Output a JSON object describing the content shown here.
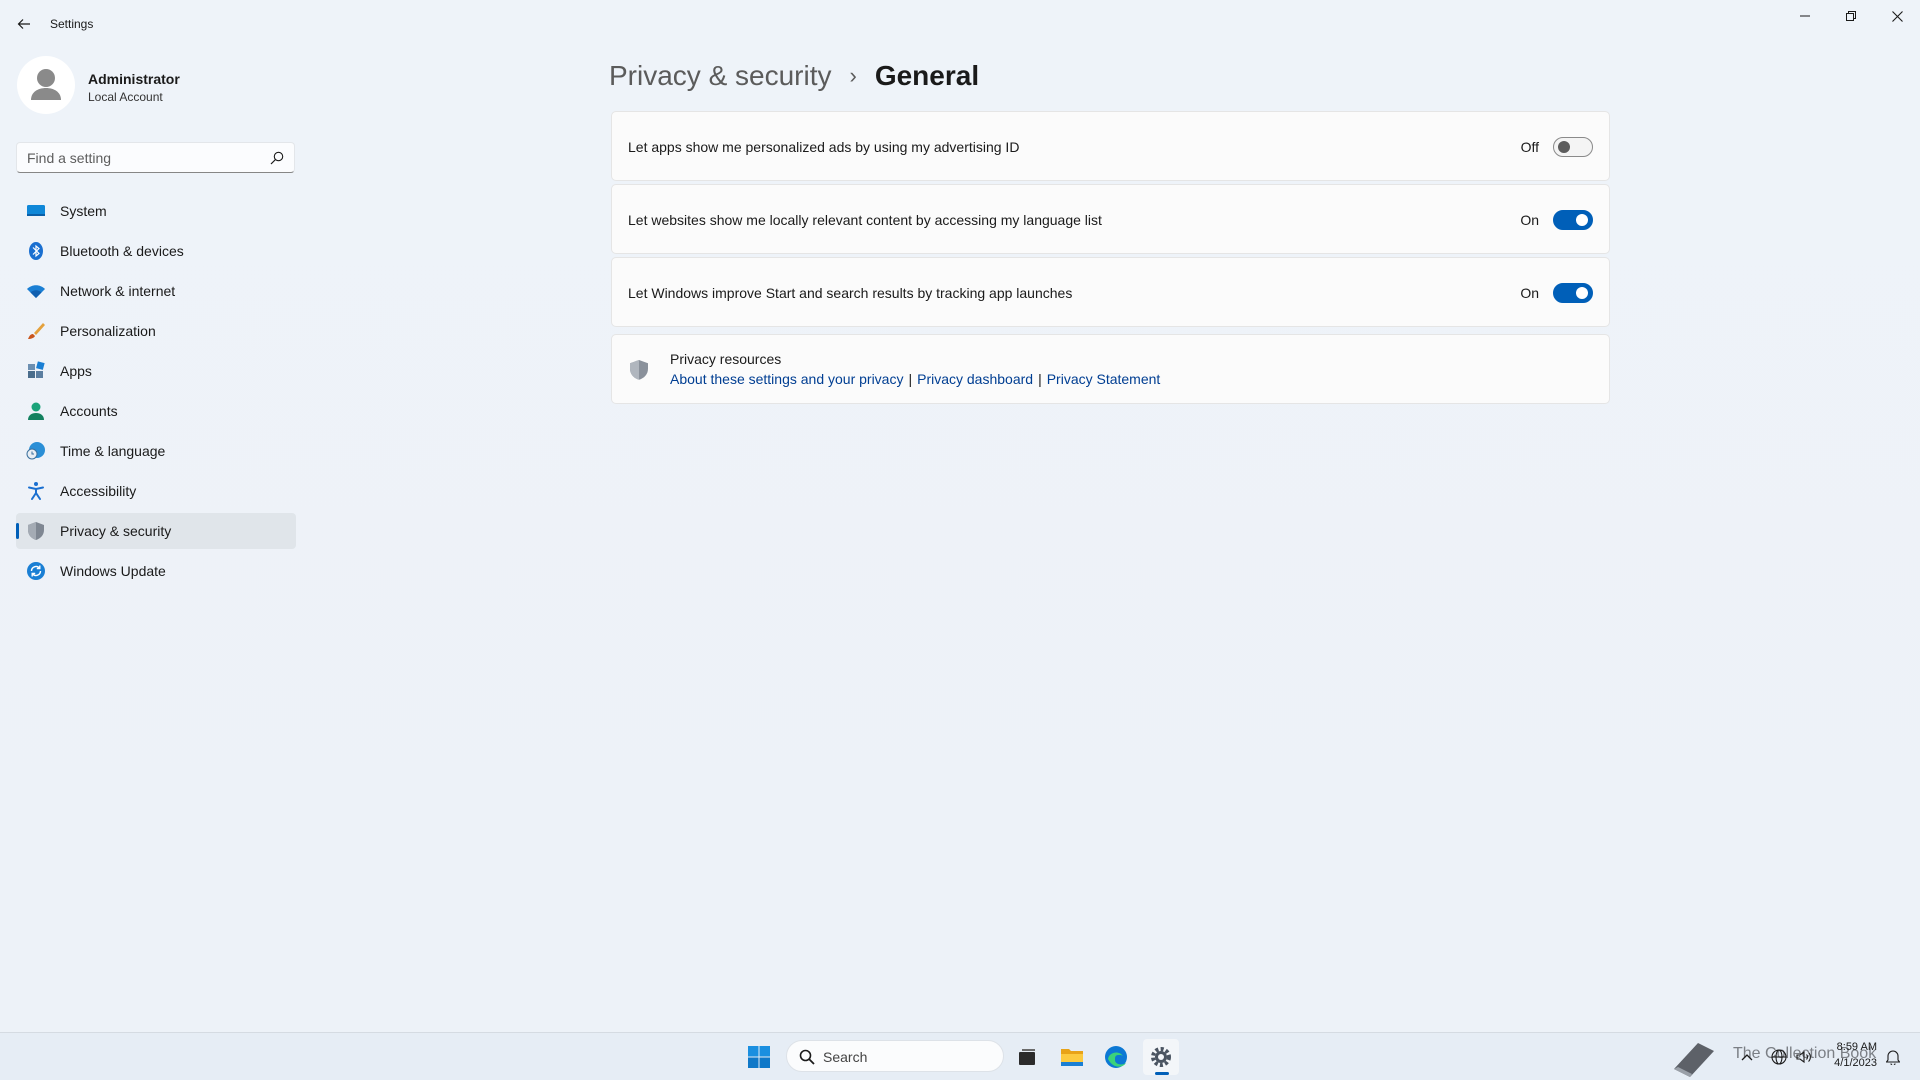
{
  "window": {
    "title": "Settings"
  },
  "profile": {
    "name": "Administrator",
    "account_type": "Local Account"
  },
  "search": {
    "placeholder": "Find a setting"
  },
  "sidebar": {
    "items": [
      {
        "label": "System",
        "icon": "system-icon"
      },
      {
        "label": "Bluetooth & devices",
        "icon": "bluetooth-icon"
      },
      {
        "label": "Network & internet",
        "icon": "wifi-icon"
      },
      {
        "label": "Personalization",
        "icon": "brush-icon"
      },
      {
        "label": "Apps",
        "icon": "apps-icon"
      },
      {
        "label": "Accounts",
        "icon": "person-icon"
      },
      {
        "label": "Time & language",
        "icon": "clock-globe-icon"
      },
      {
        "label": "Accessibility",
        "icon": "accessibility-icon"
      },
      {
        "label": "Privacy & security",
        "icon": "shield-icon",
        "active": true
      },
      {
        "label": "Windows Update",
        "icon": "update-icon"
      }
    ]
  },
  "breadcrumb": {
    "parent": "Privacy & security",
    "separator": "›",
    "current": "General"
  },
  "settings": [
    {
      "label": "Let apps show me personalized ads by using my advertising ID",
      "state": "Off",
      "on": false
    },
    {
      "label": "Let websites show me locally relevant content by accessing my language list",
      "state": "On",
      "on": true
    },
    {
      "label": "Let Windows improve Start and search results by tracking app launches",
      "state": "On",
      "on": true
    }
  ],
  "resources": {
    "title": "Privacy resources",
    "links": [
      "About these settings and your privacy",
      "Privacy dashboard",
      "Privacy Statement"
    ],
    "separator": "|"
  },
  "taskbar": {
    "search_label": "Search",
    "watermark": "The Collection Book",
    "time": "8:59 AM",
    "date": "4/1/2023"
  },
  "colors": {
    "accent": "#005fb8",
    "link": "#003e92",
    "background": "#eef3f9"
  }
}
